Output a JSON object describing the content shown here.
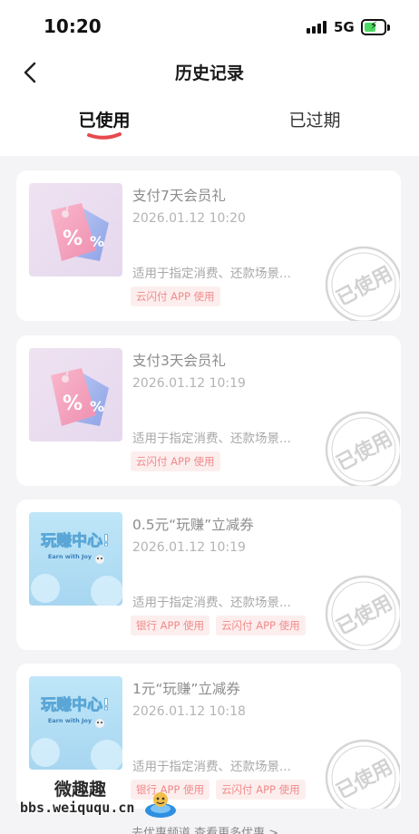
{
  "status_bar": {
    "time": "10:20",
    "network": "5G"
  },
  "header": {
    "title": "历史记录"
  },
  "tabs": [
    {
      "label": "已使用"
    },
    {
      "label": "已过期"
    }
  ],
  "stamp_text": "已使用",
  "cards": [
    {
      "title": "支付7天会员礼",
      "date": "2026.01.12 10:20",
      "scope": "适用于指定消费、还款场景...",
      "tags": [
        "云闪付 APP 使用"
      ]
    },
    {
      "title": "支付3天会员礼",
      "date": "2026.01.12 10:19",
      "scope": "适用于指定消费、还款场景...",
      "tags": [
        "云闪付 APP 使用"
      ]
    },
    {
      "title": "0.5元“玩赚”立减券",
      "date": "2026.01.12 10:19",
      "scope": "适用于指定消费、还款场景...",
      "tags": [
        "银行 APP 使用",
        "云闪付 APP 使用"
      ]
    },
    {
      "title": "1元“玩赚”立减券",
      "date": "2026.01.12 10:18",
      "scope": "适用于指定消费、还款场景...",
      "tags": [
        "银行 APP 使用",
        "云闪付 APP 使用"
      ]
    }
  ],
  "banner": {
    "main": "玩赚中心!",
    "sub": "Earn with Joy"
  },
  "watermark": {
    "line1": "微趣趣",
    "line2": "bbs.weiququ.cn"
  },
  "footer": {
    "link": "去优惠频道 查看更多优惠 >"
  },
  "colors": {
    "accent": "#e8484f",
    "tag_text": "#f08a8a",
    "tag_bg": "#fdeeee",
    "battery": "#4cd964"
  },
  "icons": [
    "back-arrow-icon",
    "signal-icon",
    "battery-icon",
    "discount-tag-icon",
    "used-stamp-icon"
  ]
}
